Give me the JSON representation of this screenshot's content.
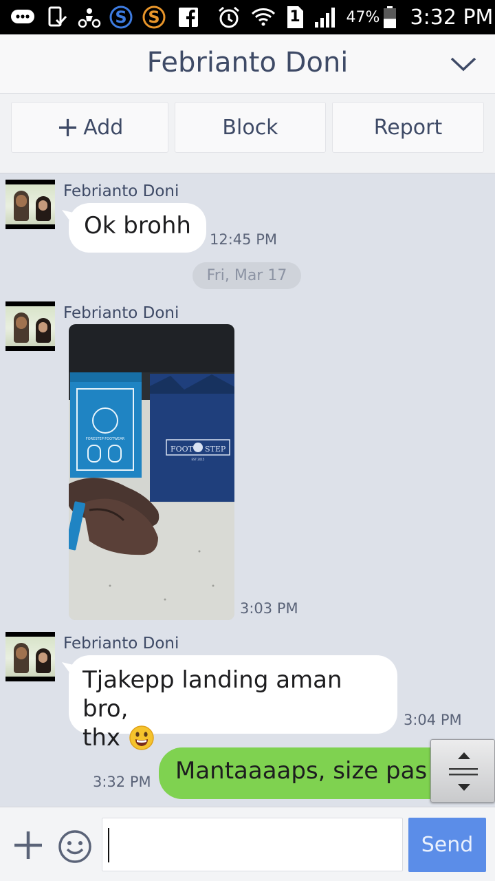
{
  "status_bar": {
    "icons": [
      "messenger-icon",
      "phone-check-icon",
      "scooter-icon",
      "s-blue-icon",
      "s-orange-icon",
      "facebook-icon",
      "alarm-icon",
      "wifi-icon",
      "sim-1-icon",
      "signal-icon",
      "battery-icon"
    ],
    "sim_label": "1",
    "battery": "47%",
    "time": "3:32 PM",
    "battery_level": 0.47
  },
  "header": {
    "title": "Febrianto Doni",
    "collapse_icon": "chevron-down-icon"
  },
  "actions": {
    "add_label": "Add",
    "block_label": "Block",
    "report_label": "Report"
  },
  "messages": [
    {
      "type": "text",
      "sender": "Febrianto Doni",
      "text": "Ok brohh",
      "time": "12:45 PM"
    },
    {
      "type": "date",
      "text": "Fri, Mar 17"
    },
    {
      "type": "image",
      "sender": "Febrianto Doni",
      "time": "3:03 PM",
      "image_text": {
        "box_brand": "FORESTEP FOOTWEAR",
        "bag_left": "FOOT",
        "bag_right": "STEP",
        "bag_sub": "EST 2015"
      }
    },
    {
      "type": "text",
      "sender": "Febrianto Doni",
      "text": "Tjakepp landing aman bro,",
      "text_line2": "thx",
      "emoji": "grinning-face-icon",
      "time": "3:04 PM"
    },
    {
      "type": "outgoing",
      "text": "Mantaaaaps, size pas sc",
      "time": "3:32 PM"
    }
  ],
  "composer": {
    "input_value": "",
    "send_label": "Send",
    "add_icon": "plus-icon",
    "sticker_icon": "smiley-icon"
  },
  "colors": {
    "chat_bg": "#dde1e9",
    "header_text": "#3e4a66",
    "outgoing_bubble": "#7fd250",
    "send_button": "#5b8de8"
  }
}
